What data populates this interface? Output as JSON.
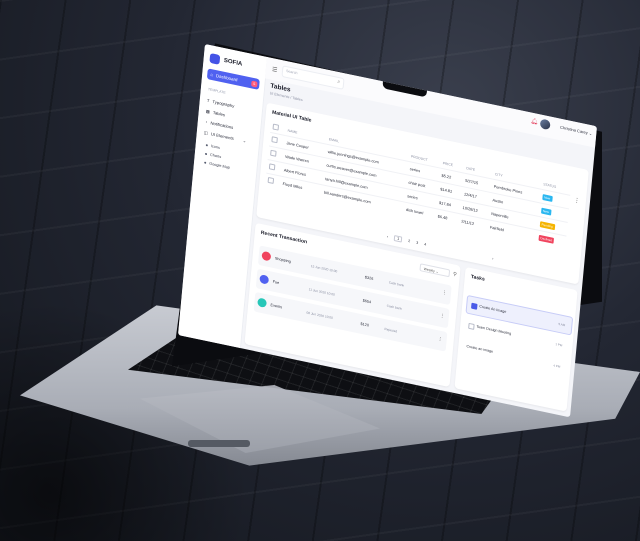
{
  "sidebar": {
    "brand": "SOFIA",
    "dashboard_label": "Dashboard",
    "dashboard_badge": "5",
    "section_label": "TEMPLATE",
    "items": [
      {
        "label": "Typography"
      },
      {
        "label": "Tables"
      },
      {
        "label": "Notifications"
      },
      {
        "label": "UI Elements"
      }
    ],
    "sub_items": [
      {
        "label": "Icons"
      },
      {
        "label": "Charts"
      },
      {
        "label": "Google Map"
      }
    ]
  },
  "topbar": {
    "search_placeholder": "Search",
    "user_name": "Christina Carey"
  },
  "page": {
    "title": "Tables",
    "breadcrumb": "UI Elements  /  Tables"
  },
  "table_card": {
    "title": "Material UI Table",
    "columns": [
      "NAME",
      "EMAIL",
      "PRODUCT",
      "PRICE",
      "DATE",
      "CITY",
      "STATUS"
    ],
    "rows": [
      {
        "name": "Jane Cooper",
        "email": "willie.jennings@example.com",
        "product": "series",
        "price": "$5.22",
        "date": "5/27/15",
        "city": "Pembroke Pines",
        "status": "New",
        "status_color": "#2bb7f0"
      },
      {
        "name": "Wade Warren",
        "email": "curtis.weaver@example.com",
        "product": "chair post",
        "price": "$14.81",
        "date": "12/4/17",
        "city": "Austin",
        "status": "New",
        "status_color": "#2bb7f0"
      },
      {
        "name": "Albert Flores",
        "email": "tanya.hill@example.com",
        "product": "series",
        "price": "$17.84",
        "date": "10/28/12",
        "city": "Naperville",
        "status": "Pending",
        "status_color": "#f5b400"
      },
      {
        "name": "Floyd Miles",
        "email": "bill.sanders@example.com",
        "product": "dish towel",
        "price": "$6.48",
        "date": "2/11/12",
        "city": "Fairfield",
        "status": "Declined",
        "status_color": "#f0445e"
      }
    ],
    "pages": [
      "1",
      "2",
      "3",
      "4"
    ],
    "prev": "‹",
    "next": "›"
  },
  "transactions": {
    "title": "Recent Transaction",
    "filter_label": "Weekly",
    "rows": [
      {
        "name": "Shopping",
        "date": "15 Jun 2020 10:00",
        "amount": "$326",
        "status": "Cash bank",
        "icon_color": "#f0445e"
      },
      {
        "name": "Fue",
        "date": "11 Jun 2020 10:00",
        "amount": "$654",
        "status": "Cash bank",
        "icon_color": "#5061f0"
      },
      {
        "name": "Events",
        "date": "08 Jun 2020 10:00",
        "amount": "$120",
        "status": "Rejected",
        "icon_color": "#27c7b8"
      }
    ]
  },
  "tasks": {
    "title": "Tasks",
    "items": [
      {
        "label": "Create An Image",
        "time": "5 AM"
      },
      {
        "label": "Team Design Meeting",
        "time": "1 PM"
      },
      {
        "label": "Create an image",
        "time": "4 PM"
      }
    ]
  },
  "colors": {
    "accent": "#5061f0",
    "danger": "#f0445e",
    "teal": "#27c7b8"
  }
}
